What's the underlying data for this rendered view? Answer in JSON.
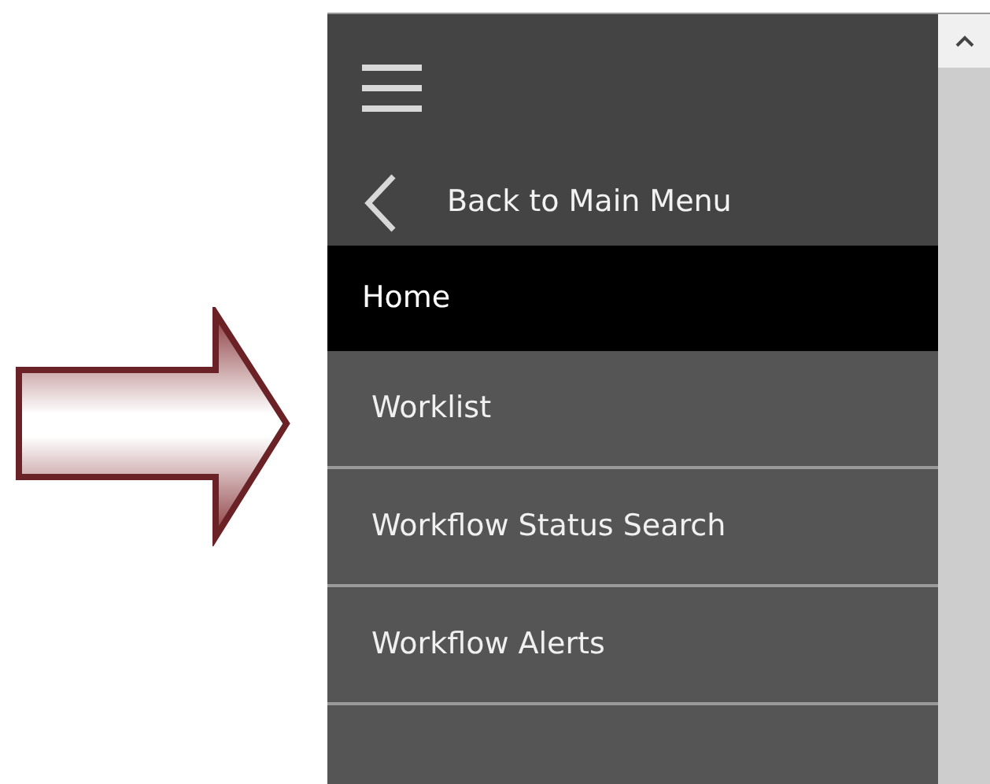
{
  "back_link": {
    "label": "Back to Main Menu"
  },
  "menu": [
    {
      "label": "Home",
      "selected": true
    },
    {
      "label": "Worklist",
      "selected": false
    },
    {
      "label": "Workflow Status Search",
      "selected": false
    },
    {
      "label": "Workflow Alerts",
      "selected": false
    }
  ]
}
